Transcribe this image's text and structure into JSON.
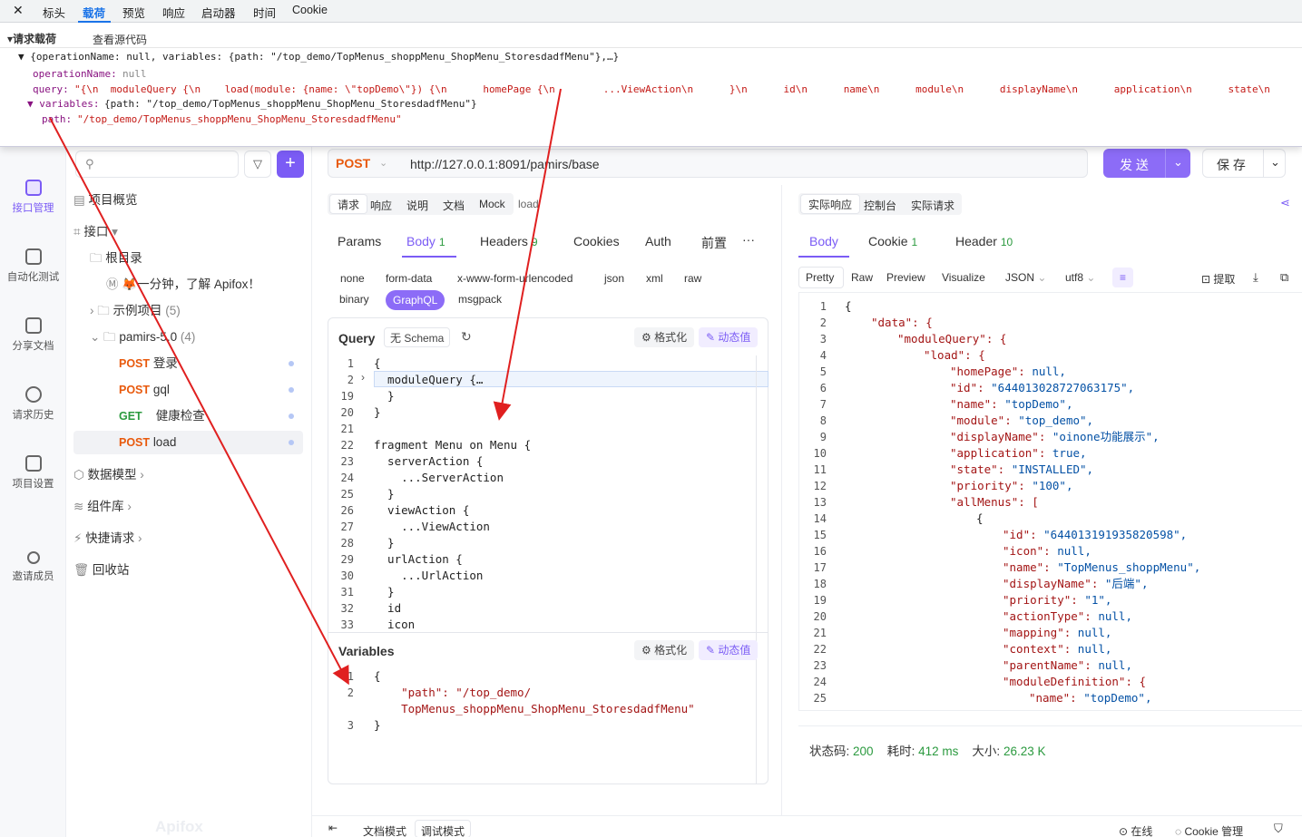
{
  "devtools": {
    "close": "✕",
    "tabs": [
      "标头",
      "载荷",
      "预览",
      "响应",
      "启动器",
      "时间",
      "Cookie"
    ],
    "payload_title": "▾请求载荷",
    "view_source": "查看源代码",
    "summary": "▼ {operationName: null, variables: {path: \"/top_demo/TopMenus_shoppMenu_ShopMenu_StoresdadfMenu\"},…}",
    "op_key": "operationName:",
    "op_val": "null",
    "query_key": "query:",
    "query_val": "\"{\\n  moduleQuery {\\n    load(module: {name: \\\"topDemo\\\"}) {\\n      homePage {\\n        ...ViewAction\\n      }\\n      id\\n      name\\n      module\\n      displayName\\n      application\\n      state\\n",
    "vars_key": "▼ variables:",
    "vars_val": "{path: \"/top_demo/TopMenus_shoppMenu_ShopMenu_StoresdadfMenu\"}",
    "path_key": "path:",
    "path_val": "\"/top_demo/TopMenus_shoppMenu_ShopMenu_StoresdadfMenu\""
  },
  "rail": [
    {
      "label": "接口管理",
      "icon": "api-icon"
    },
    {
      "label": "自动化测试",
      "icon": "automation-icon"
    },
    {
      "label": "分享文档",
      "icon": "share-doc-icon"
    },
    {
      "label": "请求历史",
      "icon": "history-icon"
    },
    {
      "label": "项目设置",
      "icon": "settings-icon"
    },
    {
      "label": "邀请成员",
      "icon": "invite-icon"
    }
  ],
  "tree": {
    "overview": "项目概览",
    "api": "接口",
    "root": "根目录",
    "intro": "🦊一分钟，了解 Apifox！",
    "examples": "示例项目",
    "examples_count": "(5)",
    "folder": "pamirs-5.0",
    "folder_count": "(4)",
    "items": [
      {
        "method": "POST",
        "name": "登录"
      },
      {
        "method": "POST",
        "name": "gql"
      },
      {
        "method": "GET",
        "name": "健康检查"
      },
      {
        "method": "POST",
        "name": "load"
      }
    ],
    "models": "数据模型",
    "components": "组件库",
    "quick": "快捷请求",
    "trash": "回收站",
    "brand": "Apifox"
  },
  "request": {
    "method": "POST",
    "url": "http://127.0.0.1:8091/pamirs/base",
    "send": "发 送",
    "save": "保 存",
    "mode_tabs": [
      "请求",
      "响应",
      "说明",
      "文档",
      "Mock",
      "load"
    ],
    "tabs": [
      "Params",
      "Body",
      "Headers",
      "Cookies",
      "Auth",
      "前置"
    ],
    "body_count": "1",
    "headers_count": "9",
    "more": "···",
    "body_types": [
      "none",
      "form-data",
      "x-www-form-urlencoded",
      "json",
      "xml",
      "raw",
      "binary",
      "GraphQL",
      "msgpack"
    ],
    "query_title": "Query",
    "schema": "无 Schema",
    "format": "格式化",
    "dynamic": "动态值",
    "variables_title": "Variables"
  },
  "query_lines": [
    [
      "1",
      "{"
    ],
    [
      "2",
      "  moduleQuery {…"
    ],
    [
      "19",
      "  }"
    ],
    [
      "20",
      "}"
    ],
    [
      "21",
      ""
    ],
    [
      "22",
      "fragment Menu on Menu {"
    ],
    [
      "23",
      "  serverAction {"
    ],
    [
      "24",
      "    ...ServerAction"
    ],
    [
      "25",
      "  }"
    ],
    [
      "26",
      "  viewAction {"
    ],
    [
      "27",
      "    ...ViewAction"
    ],
    [
      "28",
      "  }"
    ],
    [
      "29",
      "  urlAction {"
    ],
    [
      "30",
      "    ...UrlAction"
    ],
    [
      "31",
      "  }"
    ],
    [
      "32",
      "  id"
    ],
    [
      "33",
      "  icon"
    ]
  ],
  "var_lines": [
    [
      "1",
      "{"
    ],
    [
      "2",
      "    \"path\": \"/top_demo/"
    ],
    [
      "",
      "    TopMenus_shoppMenu_ShopMenu_StoresdadfMenu\""
    ],
    [
      "3",
      "}"
    ]
  ],
  "response": {
    "tabs": [
      "实际响应",
      "控制台",
      "实际请求"
    ],
    "sub_tabs": [
      "Body",
      "Cookie",
      "Header"
    ],
    "cookie_count": "1",
    "header_count": "10",
    "view_tabs": [
      "Pretty",
      "Raw",
      "Preview",
      "Visualize",
      "JSON",
      "utf8"
    ],
    "extract": "提取",
    "status_label": "状态码:",
    "status": "200",
    "time_label": "耗时:",
    "time": "412 ms",
    "size_label": "大小:",
    "size": "26.23 K"
  },
  "resp_lines": [
    [
      "1",
      0,
      "{",
      ""
    ],
    [
      "2",
      1,
      "\"data\": {",
      ""
    ],
    [
      "3",
      2,
      "\"moduleQuery\": {",
      ""
    ],
    [
      "4",
      3,
      "\"load\": {",
      ""
    ],
    [
      "5",
      4,
      "\"homePage\": ",
      "null,"
    ],
    [
      "6",
      4,
      "\"id\": ",
      "\"644013028727063175\","
    ],
    [
      "7",
      4,
      "\"name\": ",
      "\"topDemo\","
    ],
    [
      "8",
      4,
      "\"module\": ",
      "\"top_demo\","
    ],
    [
      "9",
      4,
      "\"displayName\": ",
      "\"oinone功能展示\","
    ],
    [
      "10",
      4,
      "\"application\": ",
      "true,"
    ],
    [
      "11",
      4,
      "\"state\": ",
      "\"INSTALLED\","
    ],
    [
      "12",
      4,
      "\"priority\": ",
      "\"100\","
    ],
    [
      "13",
      4,
      "\"allMenus\": [",
      ""
    ],
    [
      "14",
      5,
      "{",
      ""
    ],
    [
      "15",
      6,
      "\"id\": ",
      "\"644013191935820598\","
    ],
    [
      "16",
      6,
      "\"icon\": ",
      "null,"
    ],
    [
      "17",
      6,
      "\"name\": ",
      "\"TopMenus_shoppMenu\","
    ],
    [
      "18",
      6,
      "\"displayName\": ",
      "\"后端\","
    ],
    [
      "19",
      6,
      "\"priority\": ",
      "\"1\","
    ],
    [
      "20",
      6,
      "\"actionType\": ",
      "null,"
    ],
    [
      "21",
      6,
      "\"mapping\": ",
      "null,"
    ],
    [
      "22",
      6,
      "\"context\": ",
      "null,"
    ],
    [
      "23",
      6,
      "\"parentName\": ",
      "null,"
    ],
    [
      "24",
      6,
      "\"moduleDefinition\": {",
      ""
    ],
    [
      "25",
      7,
      "\"name\": ",
      "\"topDemo\","
    ]
  ],
  "footer": {
    "doc_mode": "文档模式",
    "debug_mode": "调试模式",
    "online": "在线",
    "cookie": "Cookie 管理"
  }
}
